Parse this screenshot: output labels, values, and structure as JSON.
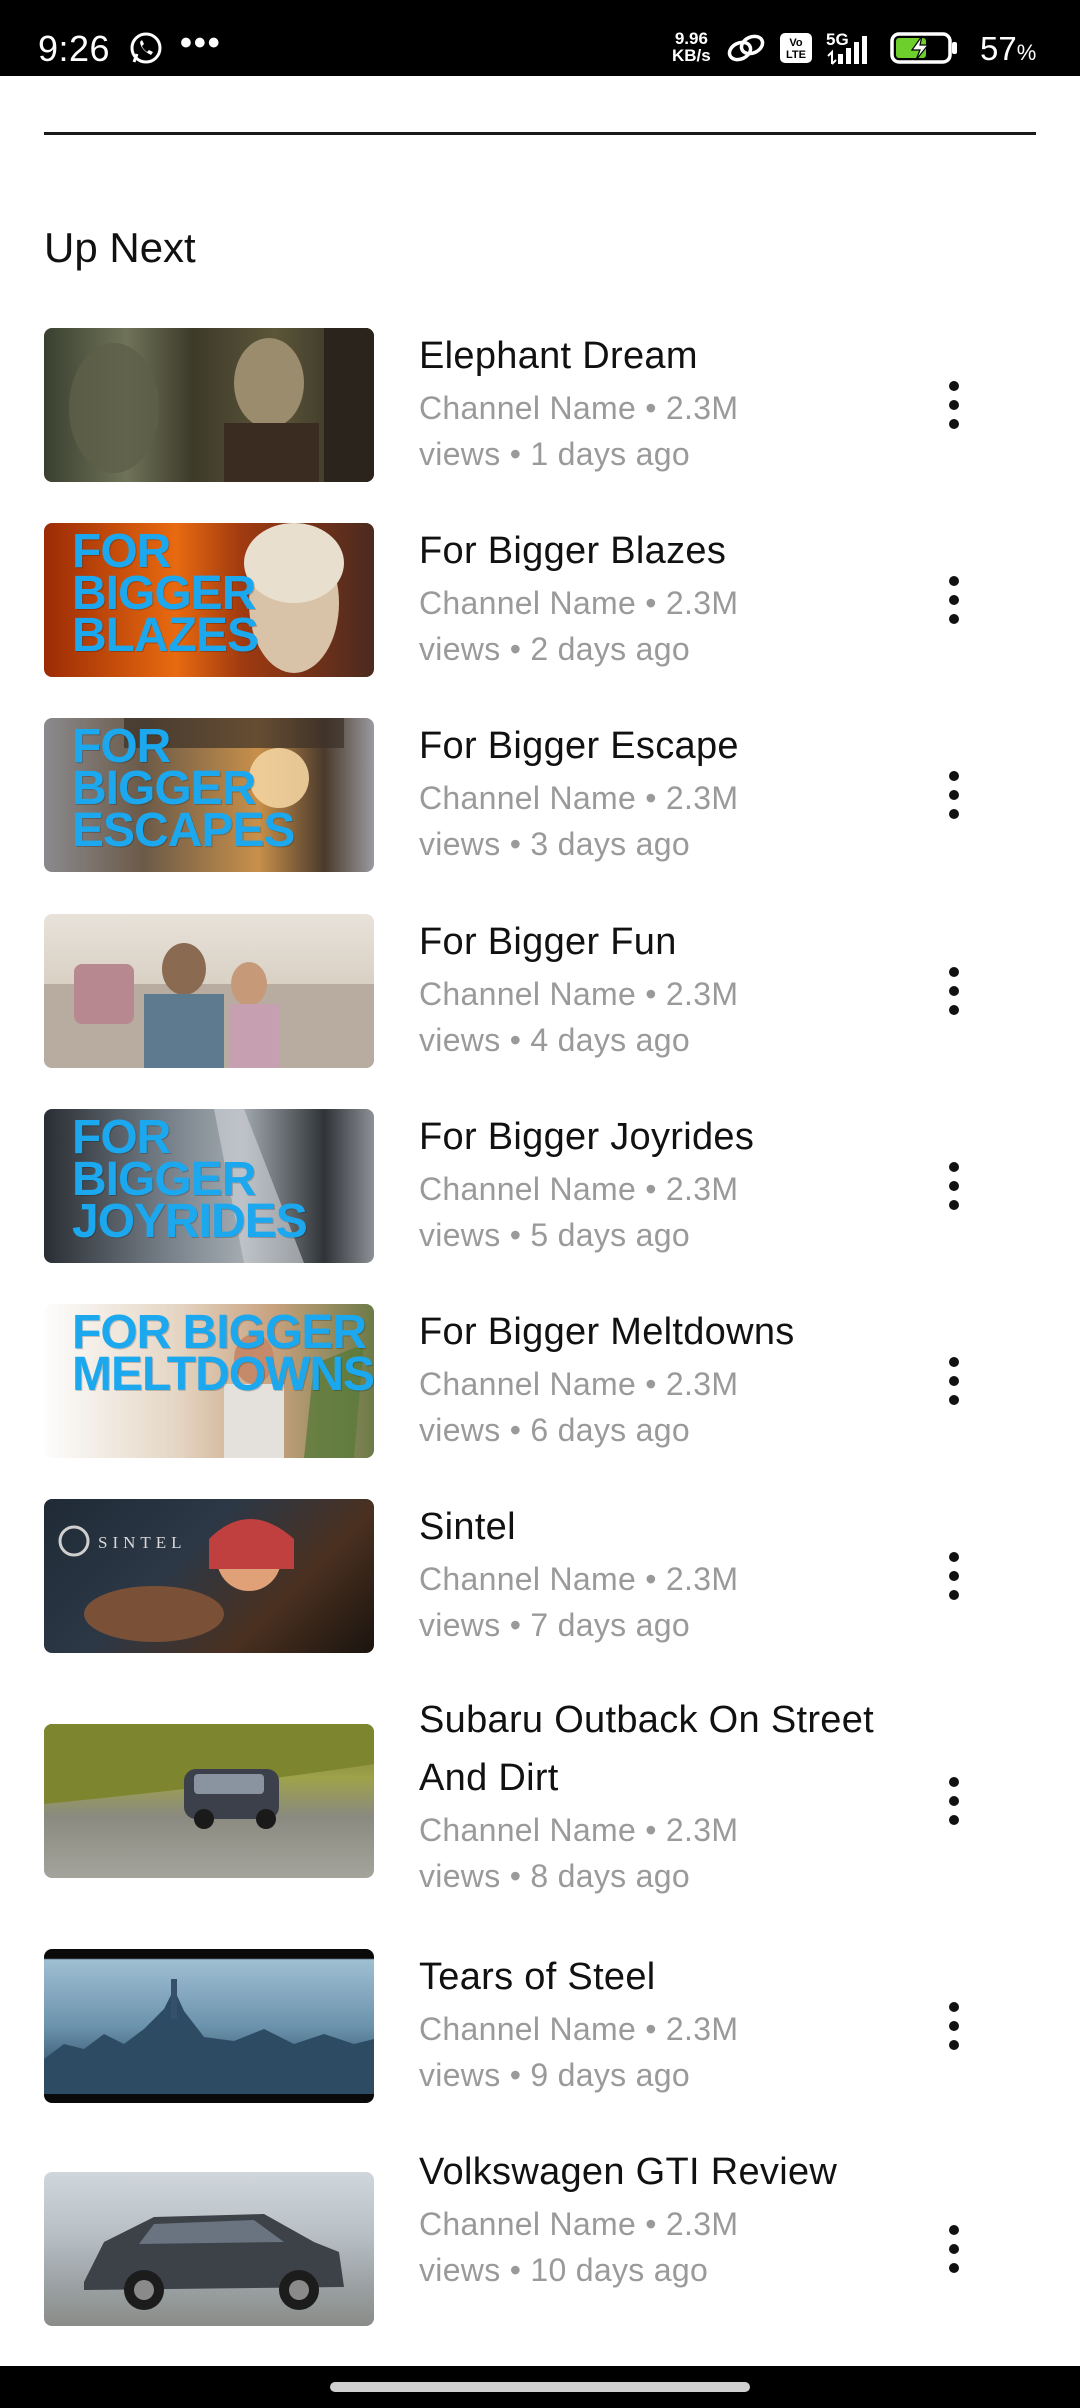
{
  "status_bar": {
    "time": "9:26",
    "more": "•••",
    "speed_value": "9.96",
    "speed_unit": "KB/s",
    "network": "5G",
    "volte": "Vo LTE",
    "battery_percent": "57",
    "battery_symbol": "%"
  },
  "section": {
    "title": "Up Next"
  },
  "videos": [
    {
      "title": "Elephant Dream",
      "sub1": "Channel Name • 2.3M",
      "sub2": "views • 1 days ago",
      "thumb_text": ""
    },
    {
      "title": "For Bigger Blazes",
      "sub1": "Channel Name • 2.3M",
      "sub2": "views • 2 days ago",
      "thumb_text": "FOR BIGGER BLAZES"
    },
    {
      "title": "For Bigger Escape",
      "sub1": "Channel Name • 2.3M",
      "sub2": "views • 3 days ago",
      "thumb_text": "FOR BIGGER ESCAPES"
    },
    {
      "title": "For Bigger Fun",
      "sub1": "Channel Name • 2.3M",
      "sub2": "views • 4 days ago",
      "thumb_text": ""
    },
    {
      "title": "For Bigger Joyrides",
      "sub1": "Channel Name • 2.3M",
      "sub2": "views • 5 days ago",
      "thumb_text": "FOR BIGGER JOYRIDES"
    },
    {
      "title": "For Bigger Meltdowns",
      "sub1": "Channel Name • 2.3M",
      "sub2": "views • 6 days ago",
      "thumb_text": "FOR BIGGER MELTDOWNS"
    },
    {
      "title": "Sintel",
      "sub1": "Channel Name • 2.3M",
      "sub2": "views • 7 days ago",
      "thumb_text": "SINTEL"
    },
    {
      "title": "Subaru Outback On Street And Dirt",
      "sub1": "Channel Name • 2.3M",
      "sub2": "views • 8 days ago",
      "thumb_text": ""
    },
    {
      "title": "Tears of Steel",
      "sub1": "Channel Name • 2.3M",
      "sub2": "views • 9 days ago",
      "thumb_text": ""
    },
    {
      "title": "Volkswagen GTI Review",
      "sub1": "Channel Name • 2.3M",
      "sub2": "views • 10 days ago",
      "thumb_text": ""
    }
  ],
  "icons": {
    "whatsapp": "whatsapp-icon",
    "hotspot": "link-icon",
    "signal": "signal-icon",
    "battery": "battery-charging-icon",
    "more": "more-vertical-icon"
  }
}
